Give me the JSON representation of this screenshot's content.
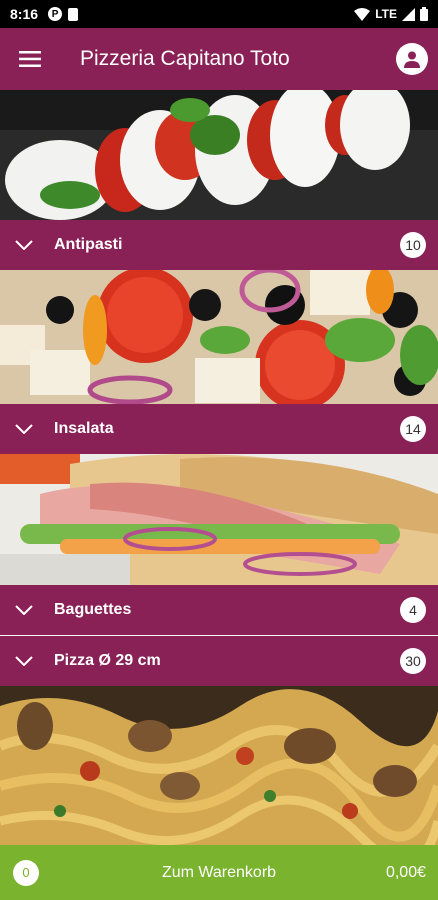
{
  "status_bar": {
    "time": "8:16",
    "p_glyph": "P",
    "network": "LTE"
  },
  "app_bar": {
    "title": "Pizzeria Capitano Toto",
    "menu_icon": "hamburger-menu-icon",
    "account_icon": "account-circle-icon"
  },
  "categories": [
    {
      "label": "Antipasti",
      "count": "10"
    },
    {
      "label": "Insalata",
      "count": "14"
    },
    {
      "label": "Baguettes",
      "count": "4"
    },
    {
      "label": "Pizza Ø 29 cm",
      "count": "30"
    }
  ],
  "cart": {
    "count": "0",
    "label": "Zum Warenkorb",
    "total": "0,00€"
  },
  "colors": {
    "primary": "#8a2156",
    "cart_green": "#7ab32e"
  }
}
